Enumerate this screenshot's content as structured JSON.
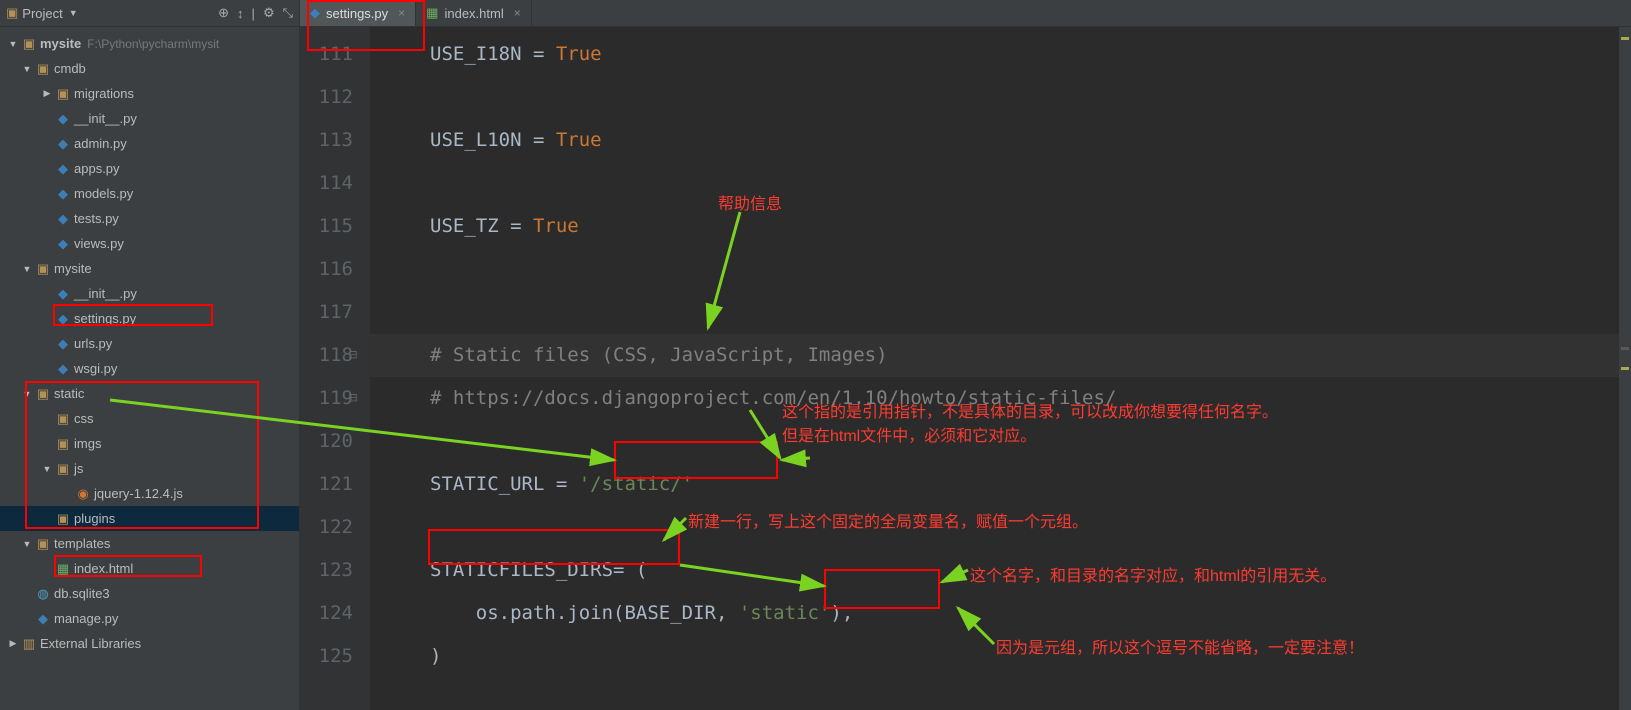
{
  "project_header": {
    "title": "Project",
    "icons": {
      "target": "⊕",
      "collapse": "↕",
      "gear": "⚙",
      "hide": "⤡"
    }
  },
  "root": {
    "name": "mysite",
    "path": "F:\\Python\\pycharm\\mysit"
  },
  "tree": [
    {
      "depth": 1,
      "arrow": "▼",
      "icon": "folder",
      "label": "cmdb"
    },
    {
      "depth": 2,
      "arrow": "▶",
      "icon": "folder",
      "label": "migrations"
    },
    {
      "depth": 2,
      "arrow": "",
      "icon": "py",
      "label": "__init__.py"
    },
    {
      "depth": 2,
      "arrow": "",
      "icon": "py",
      "label": "admin.py"
    },
    {
      "depth": 2,
      "arrow": "",
      "icon": "py",
      "label": "apps.py"
    },
    {
      "depth": 2,
      "arrow": "",
      "icon": "py",
      "label": "models.py"
    },
    {
      "depth": 2,
      "arrow": "",
      "icon": "py",
      "label": "tests.py"
    },
    {
      "depth": 2,
      "arrow": "",
      "icon": "py",
      "label": "views.py"
    },
    {
      "depth": 1,
      "arrow": "▼",
      "icon": "folder",
      "label": "mysite"
    },
    {
      "depth": 2,
      "arrow": "",
      "icon": "py",
      "label": "__init__.py"
    },
    {
      "depth": 2,
      "arrow": "",
      "icon": "py",
      "label": "settings.py"
    },
    {
      "depth": 2,
      "arrow": "",
      "icon": "py",
      "label": "urls.py"
    },
    {
      "depth": 2,
      "arrow": "",
      "icon": "py",
      "label": "wsgi.py"
    },
    {
      "depth": 1,
      "arrow": "▼",
      "icon": "folder",
      "label": "static"
    },
    {
      "depth": 2,
      "arrow": "",
      "icon": "folder",
      "label": "css"
    },
    {
      "depth": 2,
      "arrow": "",
      "icon": "folder",
      "label": "imgs"
    },
    {
      "depth": 2,
      "arrow": "▼",
      "icon": "folder",
      "label": "js"
    },
    {
      "depth": 3,
      "arrow": "",
      "icon": "js",
      "label": "jquery-1.12.4.js"
    },
    {
      "depth": 2,
      "arrow": "",
      "icon": "folder",
      "label": "plugins",
      "selected": true
    },
    {
      "depth": 1,
      "arrow": "▼",
      "icon": "folder",
      "label": "templates"
    },
    {
      "depth": 2,
      "arrow": "",
      "icon": "html",
      "label": "index.html"
    },
    {
      "depth": 1,
      "arrow": "",
      "icon": "db",
      "label": "db.sqlite3"
    },
    {
      "depth": 1,
      "arrow": "",
      "icon": "py",
      "label": "manage.py"
    }
  ],
  "external_libs": "External Libraries",
  "tabs": [
    {
      "icon": "py",
      "label": "settings.py",
      "active": true
    },
    {
      "icon": "html",
      "label": "index.html",
      "active": false
    }
  ],
  "gutter": [
    "111",
    "112",
    "113",
    "114",
    "115",
    "116",
    "117",
    "118",
    "119",
    "120",
    "121",
    "122",
    "123",
    "124",
    "125"
  ],
  "code": {
    "l111": {
      "a": "USE_I18N = ",
      "b": "True"
    },
    "l113": {
      "a": "USE_L10N = ",
      "b": "True"
    },
    "l115": {
      "a": "USE_TZ = ",
      "b": "True"
    },
    "l118": "# Static files (CSS, JavaScript, Images)",
    "l119": "# https://docs.djangoproject.com/en/1.10/howto/static-files/",
    "l121": {
      "a": "STATIC_URL = ",
      "b": "'/static/'"
    },
    "l123": {
      "a": "STATICFILES_DIRS",
      "b": "= ("
    },
    "l124": {
      "a": "    os.path.join(BASE_DIR, ",
      "b": "'static'",
      "c": "),"
    },
    "l125": ")"
  },
  "annotations": {
    "a1": "帮助信息",
    "a2_line1": "这个指的是引用指针，不是具体的目录，可以改成你想要得任何名字。",
    "a2_line2": "但是在html文件中，必须和它对应。",
    "a3": "新建一行，写上这个固定的全局变量名，赋值一个元组。",
    "a4": "这个名字，和目录的名字对应，和html的引用无关。",
    "a5": "因为是元组，所以这个逗号不能省略，一定要注意！"
  }
}
